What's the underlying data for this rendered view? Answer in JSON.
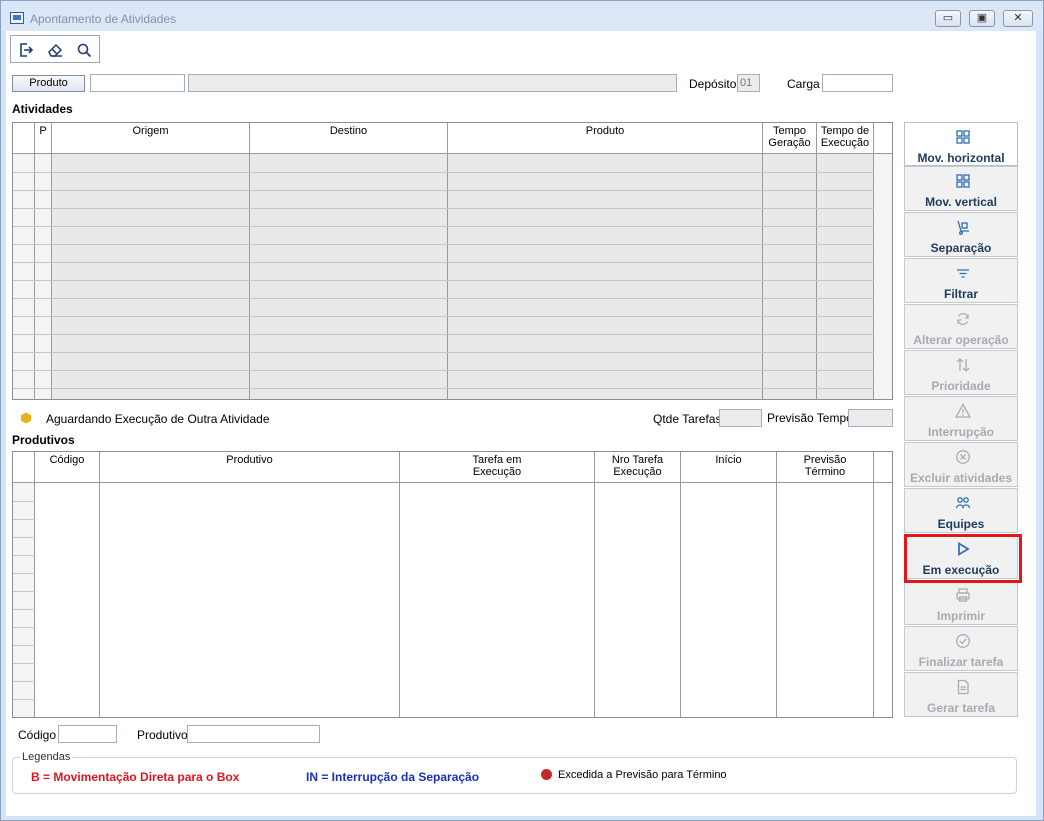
{
  "window": {
    "title": "Apontamento de Atividades",
    "controls": {
      "minimize": "▭",
      "maximize": "▣",
      "close": "✕"
    }
  },
  "toolbar": {
    "icons": [
      "exit-icon",
      "eraser-icon",
      "search-icon"
    ]
  },
  "filters": {
    "produto_button": "Produto",
    "produto_code": "",
    "produto_desc": "",
    "deposito_label": "Depósito",
    "deposito_value": "01",
    "carga_label": "Carga",
    "carga_value": ""
  },
  "atividades": {
    "title": "Atividades",
    "columns": {
      "p": "P",
      "origem": "Origem",
      "destino": "Destino",
      "produto": "Produto",
      "tempo_geracao_1": "Tempo",
      "tempo_geracao_2": "Geração",
      "tempo_execucao_1": "Tempo de",
      "tempo_execucao_2": "Execução"
    },
    "legend_text": "Aguardando Execução de Outra Atividade",
    "qtde_label": "Qtde Tarefas",
    "qtde_value": "",
    "previsao_label": "Previsão Tempo",
    "previsao_value": ""
  },
  "produtivos": {
    "title": "Produtivos",
    "columns": {
      "codigo": "Código",
      "produtivo": "Produtivo",
      "tarefa_1": "Tarefa em",
      "tarefa_2": "Execução",
      "nro_1": "Nro Tarefa",
      "nro_2": "Execução",
      "inicio": "Início",
      "previsao_1": "Previsão",
      "previsao_2": "Término"
    }
  },
  "bottom_filters": {
    "codigo_label": "Código",
    "codigo_value": "",
    "produtivo_label": "Produtivo",
    "produtivo_value": ""
  },
  "legendas": {
    "title": "Legendas",
    "b_text": "B = Movimentação Direta para o Box",
    "in_text": "IN = Interrupção da Separação",
    "excedida_text": "Excedida a Previsão para Término",
    "colors": {
      "b": "#e0161c",
      "in": "#1b2fbf",
      "excedida": "#c62828",
      "aguardando": "#e8b116"
    }
  },
  "side_actions": [
    {
      "label": "Mov. horizontal",
      "icon": "grid-move-icon",
      "enabled": true
    },
    {
      "label": "Mov. vertical",
      "icon": "grid-move-icon",
      "enabled": true
    },
    {
      "label": "Separação",
      "icon": "hand-truck-icon",
      "enabled": true
    },
    {
      "label": "Filtrar",
      "icon": "filter-icon",
      "enabled": true
    },
    {
      "label": "Alterar operação",
      "icon": "refresh-icon",
      "enabled": false
    },
    {
      "label": "Prioridade",
      "icon": "sort-arrows-icon",
      "enabled": false
    },
    {
      "label": "Interrupção",
      "icon": "warning-icon",
      "enabled": false
    },
    {
      "label": "Excluir atividades",
      "icon": "delete-circle-icon",
      "enabled": false
    },
    {
      "label": "Equipes",
      "icon": "team-icon",
      "enabled": true
    },
    {
      "label": "Em execução",
      "icon": "play-icon",
      "enabled": true
    },
    {
      "label": "Imprimir",
      "icon": "printer-icon",
      "enabled": false
    },
    {
      "label": "Finalizar tarefa",
      "icon": "check-circle-icon",
      "enabled": false
    },
    {
      "label": "Gerar tarefa",
      "icon": "document-icon",
      "enabled": false
    }
  ]
}
